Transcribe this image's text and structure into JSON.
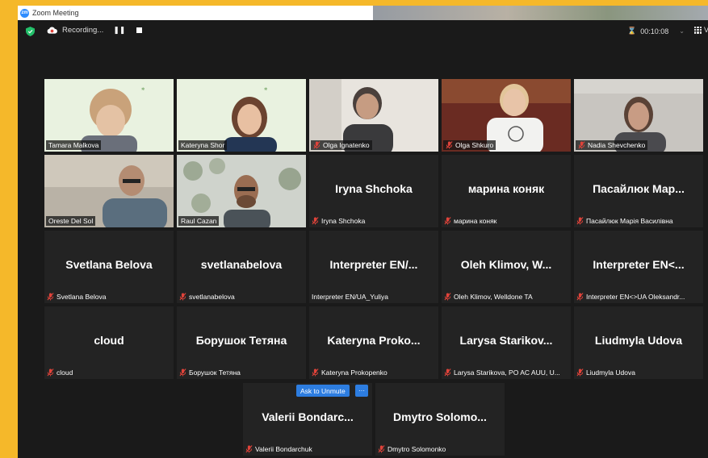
{
  "window": {
    "title": "Zoom Meeting",
    "logo_text": "zm"
  },
  "toolbar": {
    "recording_label": "Recording...",
    "timer": "00:10:08",
    "view_label": "V"
  },
  "colors": {
    "accent_blue": "#2d7de0",
    "active_speaker_border": "#c7e03f",
    "muted_red": "#e0433a",
    "background_frame": "#f5b82a"
  },
  "participants": [
    {
      "display_name": "Tamara Malkova",
      "big_name": "",
      "has_video": true,
      "muted": false
    },
    {
      "display_name": "Kateryna Shor",
      "big_name": "",
      "has_video": true,
      "muted": false
    },
    {
      "display_name": "Olga Ignatenko",
      "big_name": "",
      "has_video": true,
      "muted": true
    },
    {
      "display_name": "Olga Shkuro",
      "big_name": "",
      "has_video": true,
      "muted": true
    },
    {
      "display_name": "Nadia Shevchenko",
      "big_name": "",
      "has_video": true,
      "muted": true
    },
    {
      "display_name": "Oreste Del Sol",
      "big_name": "",
      "has_video": true,
      "muted": false,
      "active": true
    },
    {
      "display_name": "Raul Cazan",
      "big_name": "",
      "has_video": true,
      "muted": false
    },
    {
      "display_name": "Iryna Shchoka",
      "big_name": "Iryna Shchoka",
      "has_video": false,
      "muted": true
    },
    {
      "display_name": "марина коняк",
      "big_name": "марина коняк",
      "has_video": false,
      "muted": true
    },
    {
      "display_name": "Пасайлюк Марія Василівна",
      "big_name": "Пасайлюк Мар...",
      "has_video": false,
      "muted": true
    },
    {
      "display_name": "Svetlana Belova",
      "big_name": "Svetlana Belova",
      "has_video": false,
      "muted": true
    },
    {
      "display_name": "svetlanabelova",
      "big_name": "svetlanabelova",
      "has_video": false,
      "muted": true
    },
    {
      "display_name": "Interpreter EN/UA_Yuliya",
      "big_name": "Interpreter EN/...",
      "has_video": false,
      "muted": false
    },
    {
      "display_name": "Oleh Klimov, Welldone TA",
      "big_name": "Oleh Klimov, W...",
      "has_video": false,
      "muted": true
    },
    {
      "display_name": "Interpreter EN<>UA Oleksandr...",
      "big_name": "Interpreter EN<...",
      "has_video": false,
      "muted": true
    },
    {
      "display_name": "cloud",
      "big_name": "cloud",
      "has_video": false,
      "muted": true
    },
    {
      "display_name": "Борушок Тетяна",
      "big_name": "Борушок Тетяна",
      "has_video": false,
      "muted": true
    },
    {
      "display_name": "Kateryna Prokopenko",
      "big_name": "Kateryna Proko...",
      "has_video": false,
      "muted": true
    },
    {
      "display_name": "Larysa Starikova, PO AC AUU, U...",
      "big_name": "Larysa Starikov...",
      "has_video": false,
      "muted": true
    },
    {
      "display_name": "Liudmyla Udova",
      "big_name": "Liudmyla Udova",
      "has_video": false,
      "muted": true
    },
    {
      "display_name": "Valerii Bondarchuk",
      "big_name": "Valerii Bondarc...",
      "has_video": false,
      "muted": true,
      "hover": true
    },
    {
      "display_name": "Dmytro Solomonko",
      "big_name": "Dmytro Solomo...",
      "has_video": false,
      "muted": true
    }
  ],
  "hover_controls": {
    "ask_to_unmute": "Ask to Unmute",
    "more": "···"
  },
  "icons": [
    "shield-icon",
    "cloud-record-icon",
    "pause-icon",
    "stop-icon",
    "hourglass-icon",
    "gallery-view-icon",
    "muted-mic-icon"
  ]
}
